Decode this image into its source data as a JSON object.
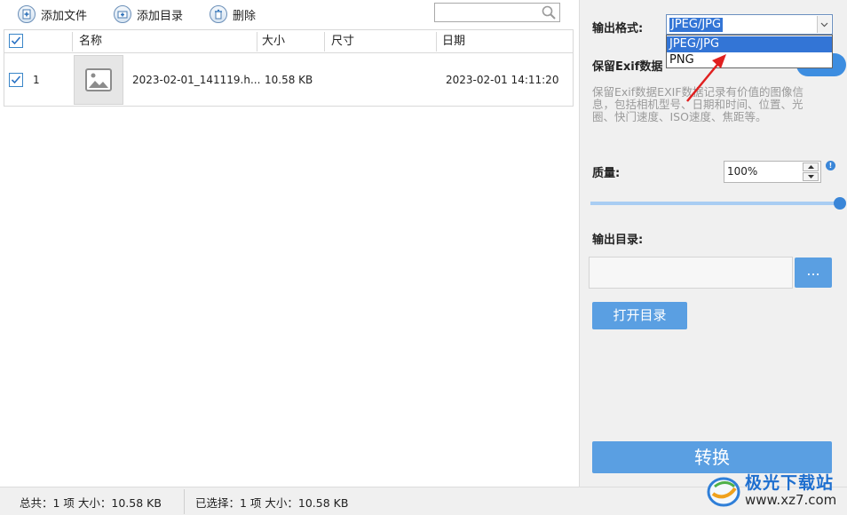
{
  "toolbar": {
    "add_file": "添加文件",
    "add_folder": "添加目录",
    "delete": "删除",
    "search_placeholder": ""
  },
  "table": {
    "headers": [
      "名称",
      "大小",
      "尺寸",
      "日期"
    ],
    "rows": [
      {
        "index": "1",
        "name": "2023-02-01_141119.h...",
        "size": "10.58 KB",
        "dimensions": "",
        "date": "2023-02-01 14:11:20",
        "checked": true
      }
    ]
  },
  "panel": {
    "output_format_label": "输出格式:",
    "format_selected": "JPEG/JPG",
    "format_options": [
      "JPEG/JPG",
      "PNG"
    ],
    "keep_exif_label": "保留Exif数据",
    "exif_description": "保留Exif数据EXIF数据记录有价值的图像信息，包括相机型号、日期和时间、位置、光圈、快门速度、ISO速度、焦距等。",
    "quality_label": "质量:",
    "quality_value": "100%",
    "quality_level": 1.0,
    "info_symbol": "!",
    "output_dir_label": "输出目录:",
    "output_dir_value": "",
    "browse_label": "...",
    "open_dir_label": "打开目录",
    "convert_label": "转换"
  },
  "status": {
    "total": "总共：1 项 大小：10.58 KB",
    "selected": "已选择：1 项 大小：10.58 KB"
  },
  "watermark": {
    "name": "极光下载站",
    "url": "www.xz7.com"
  },
  "colors": {
    "accent": "#5a9fe2",
    "select_highlight": "#3375d6",
    "arrow": "#e02020"
  }
}
